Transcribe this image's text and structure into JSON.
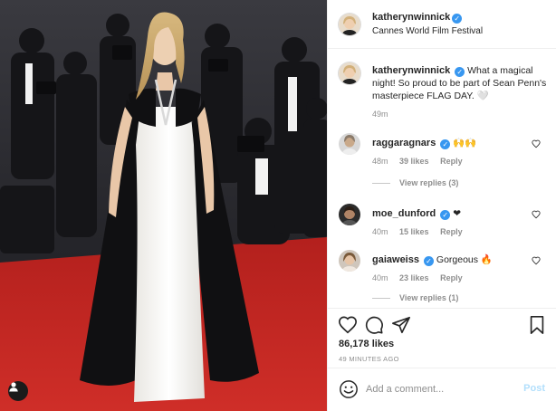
{
  "post": {
    "author": "katherynwinnick",
    "location": "Cannes World Film Festival",
    "verified_icon": "verified-badge-icon",
    "brand_blue": "#3897f0"
  },
  "caption": {
    "username": "katherynwinnick",
    "text": "What a magical night! So proud to be part of Sean Penn's masterpiece FLAG DAY. 🤍",
    "time": "49m"
  },
  "comments": [
    {
      "username": "raggaragnars",
      "text": "🙌🙌",
      "time": "48m",
      "likes": "39 likes",
      "reply": "Reply",
      "view_replies": "View replies (3)"
    },
    {
      "username": "moe_dunford",
      "text": "❤",
      "time": "40m",
      "likes": "15 likes",
      "reply": "Reply"
    },
    {
      "username": "gaiaweiss",
      "text": "Gorgeous 🔥",
      "time": "40m",
      "likes": "23 likes",
      "reply": "Reply",
      "view_replies": "View replies (1)"
    }
  ],
  "actions": {
    "likes": "86,178 likes",
    "posted_ago": "49 MINUTES AGO",
    "icons": [
      "heart-icon",
      "comment-icon",
      "share-icon",
      "bookmark-icon"
    ]
  },
  "composer": {
    "placeholder": "Add a comment...",
    "post_label": "Post",
    "post_color": "#b2dffc"
  }
}
